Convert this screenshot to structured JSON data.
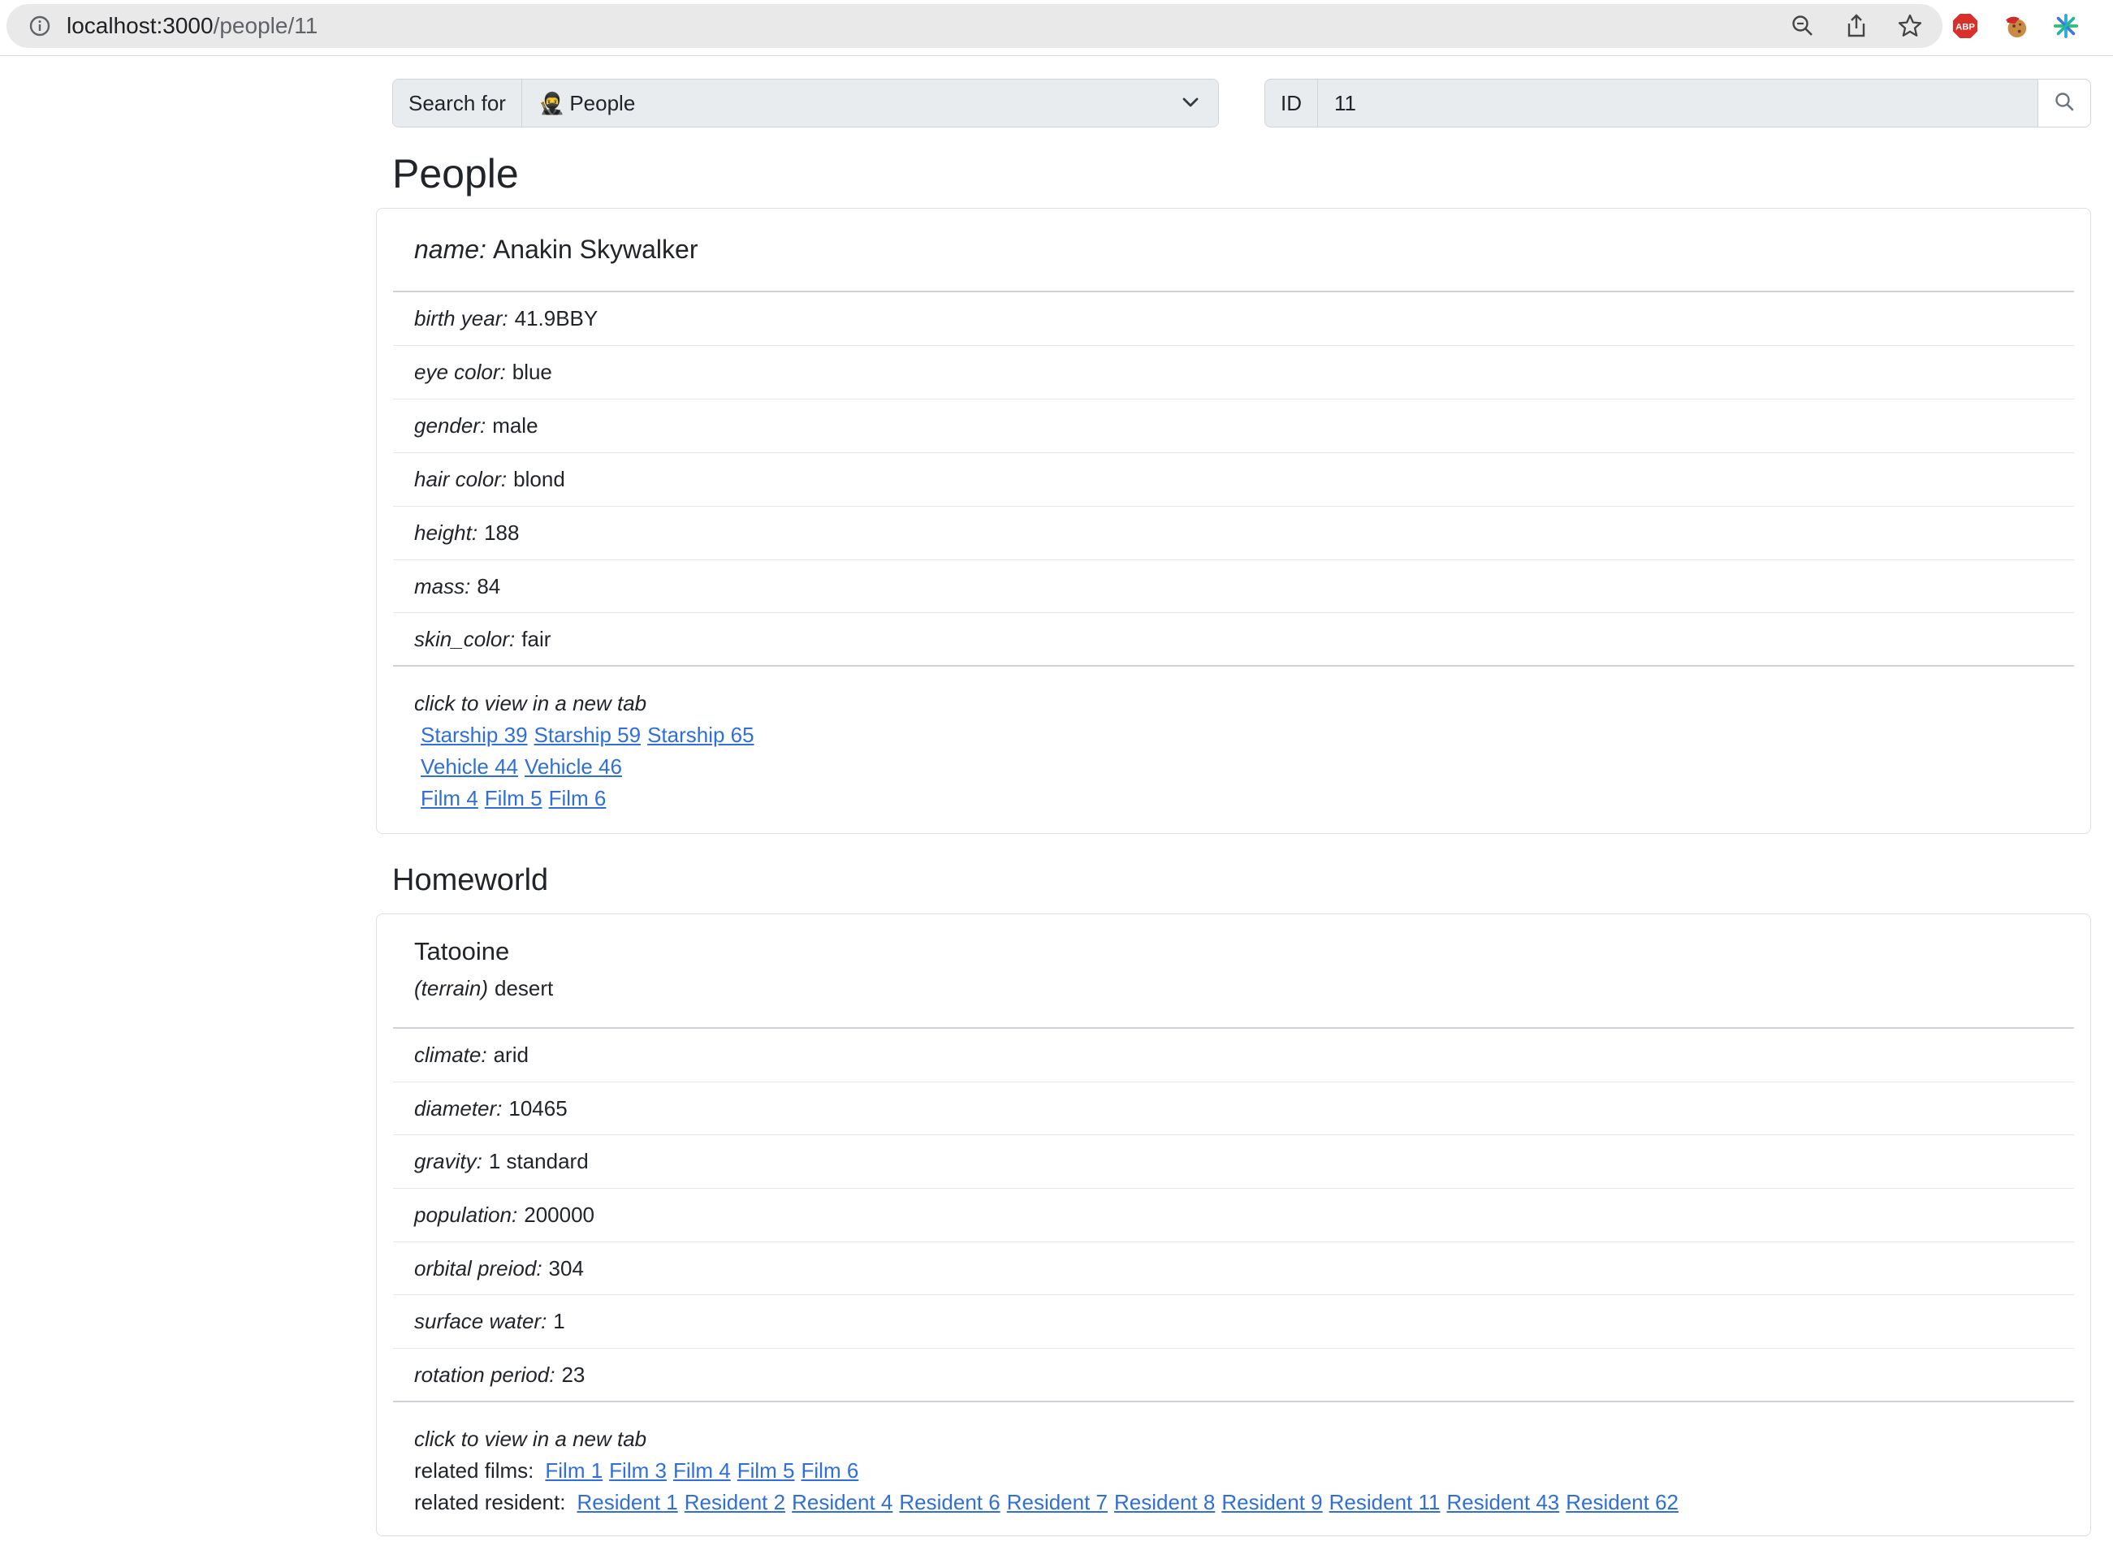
{
  "browser": {
    "url_host": "localhost:3000",
    "url_path": "/people/11"
  },
  "search": {
    "label": "Search for",
    "category_emoji": "🥷",
    "category": "People",
    "id_label": "ID",
    "id_value": "11"
  },
  "people": {
    "heading": "People",
    "name_label": "name:",
    "name": "Anakin Skywalker",
    "fields": [
      {
        "label": "birth year:",
        "value": "41.9BBY"
      },
      {
        "label": "eye color:",
        "value": "blue"
      },
      {
        "label": "gender:",
        "value": "male"
      },
      {
        "label": "hair color:",
        "value": "blond"
      },
      {
        "label": "height:",
        "value": "188"
      },
      {
        "label": "mass:",
        "value": "84"
      },
      {
        "label": "skin_color:",
        "value": "fair"
      }
    ],
    "links_caption": "click to view in a new tab",
    "starships": [
      "Starship 39",
      "Starship 59",
      "Starship 65"
    ],
    "vehicles": [
      "Vehicle 44",
      "Vehicle 46"
    ],
    "films": [
      "Film 4",
      "Film 5",
      "Film 6"
    ]
  },
  "homeworld": {
    "heading": "Homeworld",
    "name": "Tatooine",
    "terrain_label": "(terrain)",
    "terrain": "desert",
    "fields": [
      {
        "label": "climate:",
        "value": "arid"
      },
      {
        "label": "diameter:",
        "value": "10465"
      },
      {
        "label": "gravity:",
        "value": "1 standard"
      },
      {
        "label": "population:",
        "value": "200000"
      },
      {
        "label": "orbital preiod:",
        "value": "304"
      },
      {
        "label": "surface water:",
        "value": "1"
      },
      {
        "label": "rotation period:",
        "value": "23"
      }
    ],
    "links_caption": "click to view in a new tab",
    "films_label": "related films:",
    "films": [
      "Film 1",
      "Film 3",
      "Film 4",
      "Film 5",
      "Film 6"
    ],
    "residents_label": "related resident:",
    "residents": [
      "Resident 1",
      "Resident 2",
      "Resident 4",
      "Resident 6",
      "Resident 7",
      "Resident 8",
      "Resident 9",
      "Resident 11",
      "Resident 43",
      "Resident 62"
    ]
  },
  "icons": {
    "site_info": "info-icon",
    "zoom": "zoom-icon",
    "share": "share-icon",
    "bookmark": "star-icon",
    "adblock": "adblock-icon",
    "cookie": "cookie-icon",
    "extension": "sparkle-icon",
    "search": "search-icon",
    "dropdown": "chevron-down-icon"
  },
  "colors": {
    "link": "#2f6fdb",
    "adblock_red": "#d9302c"
  }
}
